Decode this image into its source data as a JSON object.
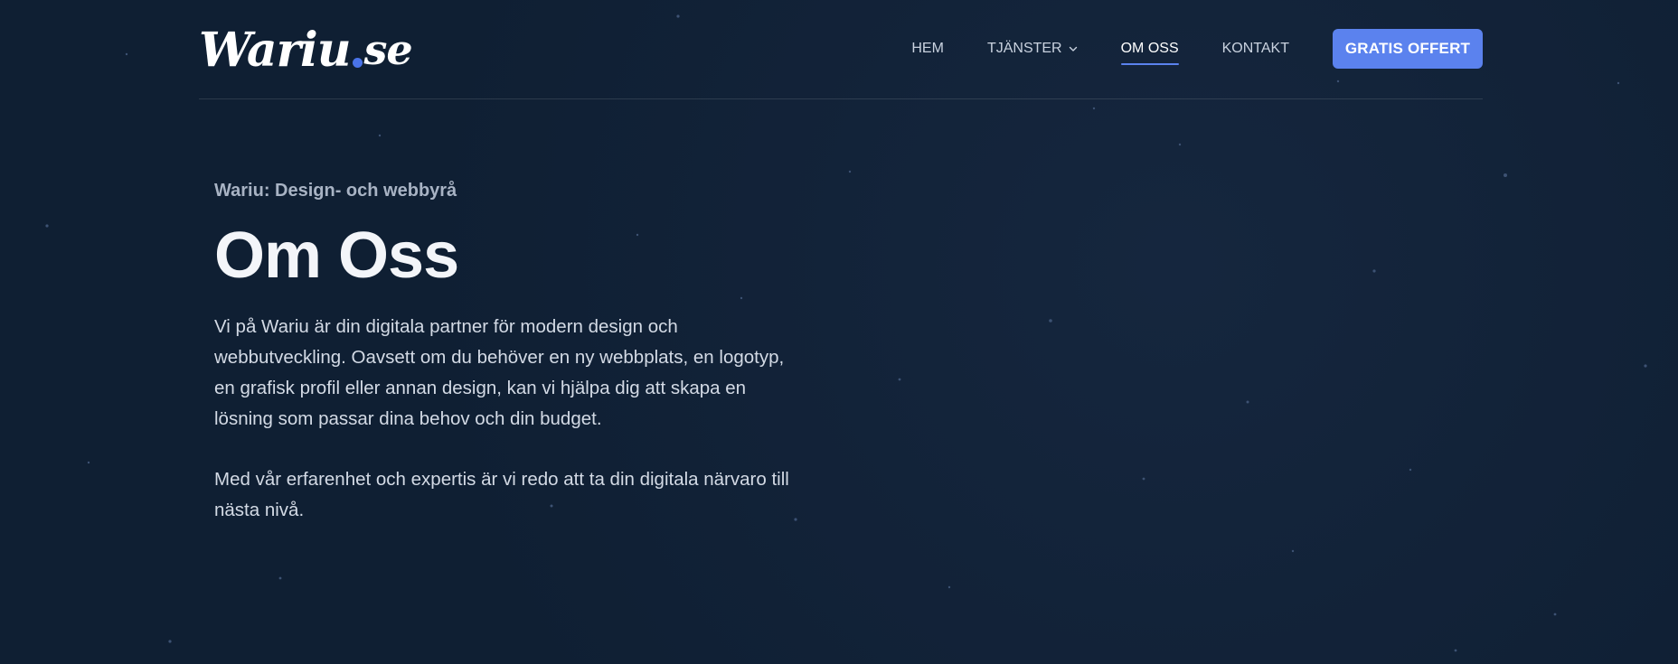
{
  "brand": {
    "logo_word": "Wariu",
    "logo_tld": "se",
    "accent_color": "#5b82ee"
  },
  "nav": {
    "items": [
      {
        "label": "HEM",
        "active": false
      },
      {
        "label": "TJÄNSTER",
        "active": false,
        "has_dropdown": true
      },
      {
        "label": "OM OSS",
        "active": true
      },
      {
        "label": "KONTAKT",
        "active": false
      }
    ],
    "cta_label": "GRATIS OFFERT"
  },
  "hero": {
    "eyebrow": "Wariu: Design- och webbyrå",
    "title": "Om Oss",
    "paragraphs": [
      "Vi på Wariu är din digitala partner för modern design och webbutveckling. Oavsett om du behöver en ny webbplats, en logotyp, en grafisk profil eller annan design, kan vi hjälpa dig att skapa en lösning som passar dina behov och din budget.",
      "Med vår erfarenhet och expertis är vi redo att ta din digitala närvaro till nästa nivå."
    ]
  },
  "icons": {
    "dropdown": "chevron-down-icon"
  }
}
